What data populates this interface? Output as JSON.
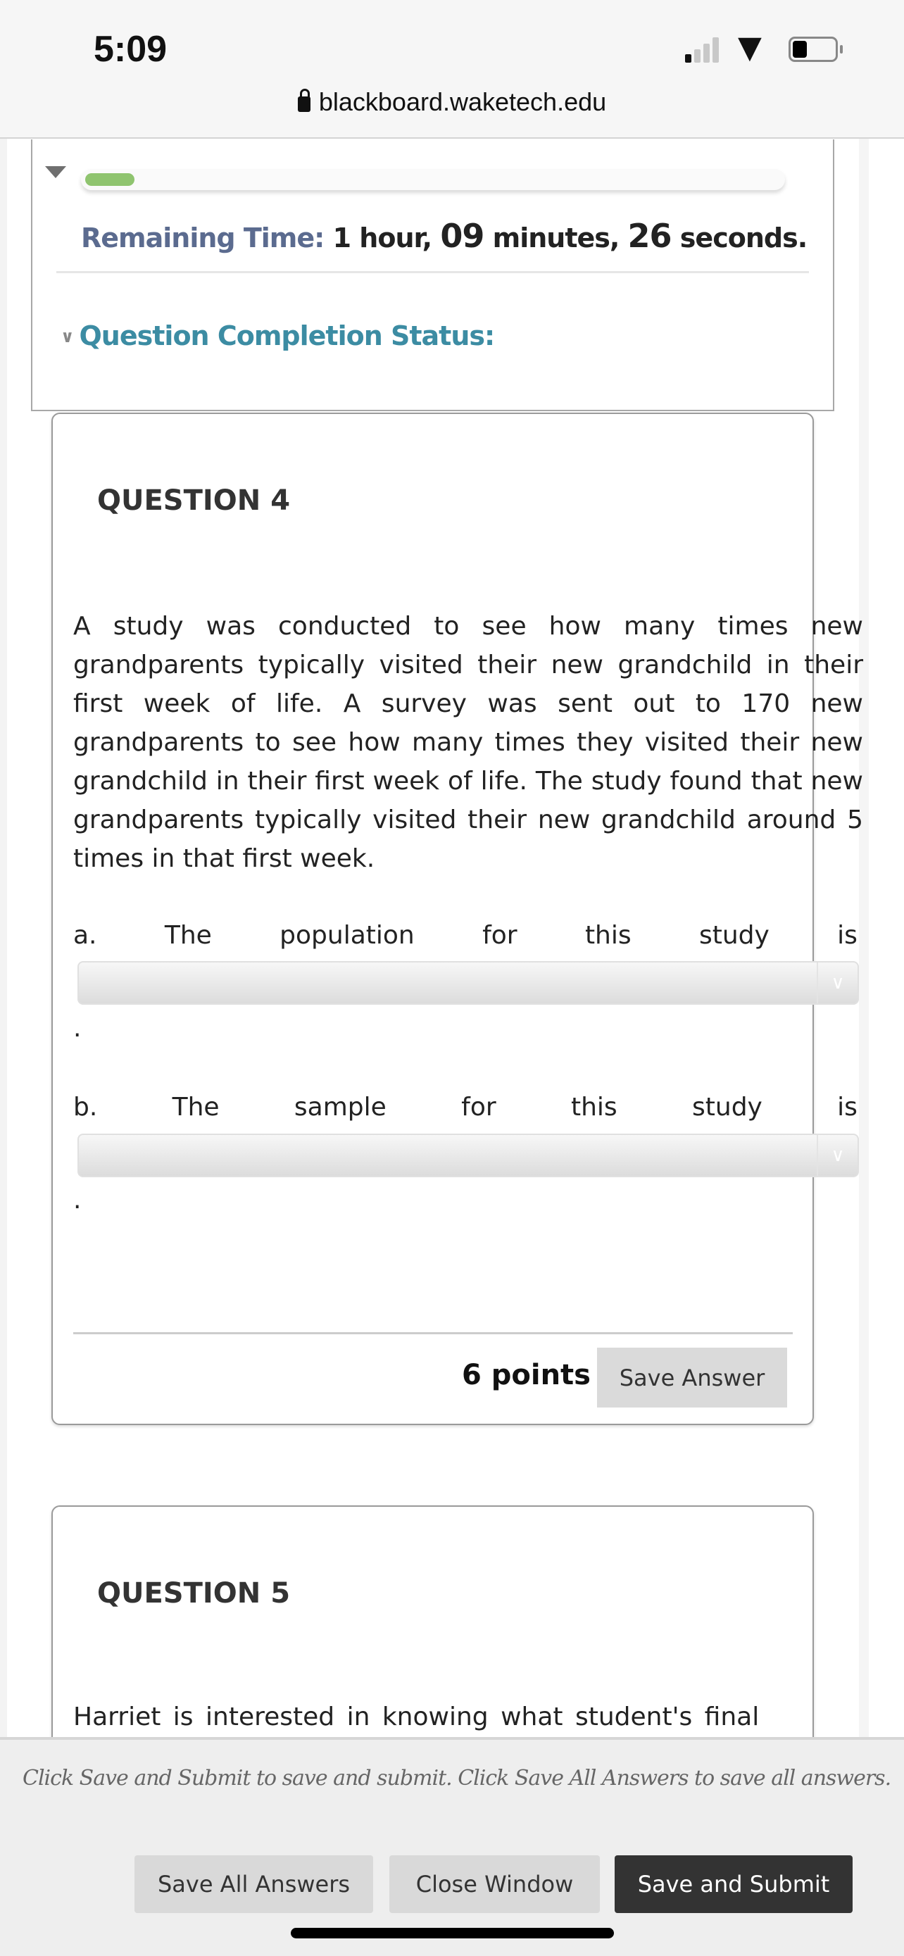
{
  "status_bar": {
    "time": "5:09",
    "signal_bars_active": 1,
    "battery_level": 0.3
  },
  "browser": {
    "url": "blackboard.waketech.edu",
    "lock_icon": "lock-icon"
  },
  "timer": {
    "progress_percent": 7,
    "progress_color": "#8fc46f",
    "label": "Remaining Time:",
    "hours": "1",
    "hours_unit": "hour,",
    "minutes": "09",
    "minutes_unit": "minutes,",
    "seconds": "26",
    "seconds_unit": "seconds."
  },
  "completion_status": {
    "label": "Question Completion Status:"
  },
  "question4": {
    "title": "QUESTION 4",
    "text": "A study was conducted to see how many times new grandparents typically visited their new grandchild in their first week of life. A survey was sent out to 170 new grandparents to see how many times they visited their new grandchild in their first week of life. The study found that new grandparents typically visited their new grandchild around 5 times in that first week.",
    "part_a": [
      "a.",
      "The",
      "population",
      "for",
      "this",
      "study",
      "is"
    ],
    "part_b": [
      "b.",
      "The",
      "sample",
      "for",
      "this",
      "study",
      "is"
    ],
    "period": ".",
    "points": "6 points",
    "save_answer": "Save Answer"
  },
  "question5": {
    "title": "QUESTION 5",
    "text": "Harriet is interested in knowing what student's final"
  },
  "footer": {
    "hint": "Click Save and Submit to save and submit. Click Save All Answers to save all answers.",
    "save_all": "Save All Answers",
    "close_window": "Close Window",
    "save_submit": "Save and Submit"
  }
}
